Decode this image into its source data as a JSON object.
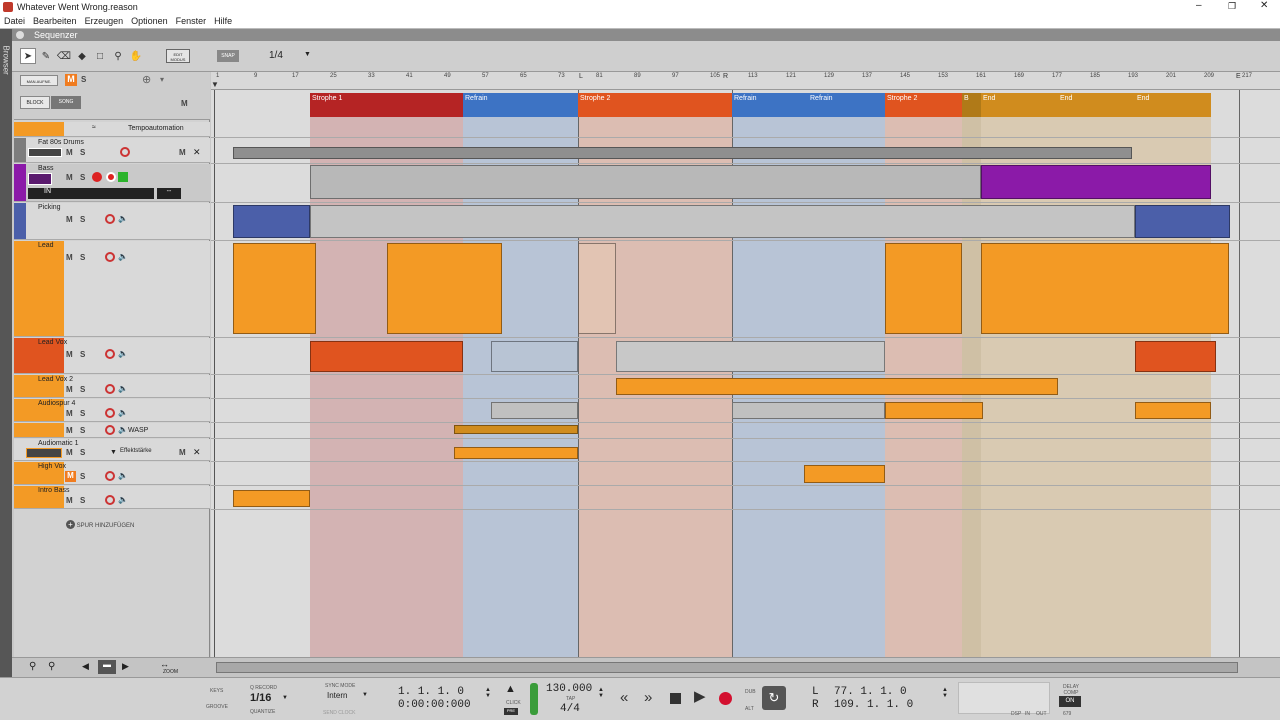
{
  "window": {
    "title": "Whatever Went Wrong.reason"
  },
  "menu": [
    "Datei",
    "Bearbeiten",
    "Erzeugen",
    "Optionen",
    "Fenster",
    "Hilfe"
  ],
  "browser_label": "Browser",
  "sequencer": {
    "title": "Sequenzer"
  },
  "toolbar": {
    "edit_mode": "EDIT MODUS",
    "snap": "SNAP",
    "snap_value": "1/4"
  },
  "header": {
    "man_aufn": "MAN.AUFNE.",
    "mute": "M",
    "solo": "S",
    "block": "BLOCK",
    "song": "SONG",
    "m": "M"
  },
  "ruler": [
    "1",
    "9",
    "17",
    "25",
    "33",
    "41",
    "49",
    "57",
    "65",
    "73",
    "81",
    "89",
    "97",
    "105",
    "113",
    "121",
    "129",
    "137",
    "145",
    "153",
    "161",
    "169",
    "177",
    "185",
    "193",
    "201",
    "209",
    "217"
  ],
  "sections": [
    {
      "label": "Strophe 1",
      "color": "#b52424"
    },
    {
      "label": "Refrain",
      "color": "#3d73c4"
    },
    {
      "label": "Strophe 2",
      "color": "#e0541f"
    },
    {
      "label": "Refrain",
      "color": "#3d73c4"
    },
    {
      "label": "Refrain",
      "color": "#3d73c4"
    },
    {
      "label": "Strophe 2",
      "color": "#e0541f"
    },
    {
      "label": "B",
      "color": "#b07a18"
    },
    {
      "label": "End",
      "color": "#d08c1e"
    },
    {
      "label": "End",
      "color": "#d08c1e"
    },
    {
      "label": "End",
      "color": "#d08c1e"
    }
  ],
  "tracks": [
    {
      "name": "Tempoautomation"
    },
    {
      "name": "Fat 80s Drums"
    },
    {
      "name": "Bass"
    },
    {
      "name": "Picking"
    },
    {
      "name": "Lead"
    },
    {
      "name": "Lead Vox"
    },
    {
      "name": "Lead Vox 2"
    },
    {
      "name": "Audiospur 4"
    },
    {
      "name": "WASP"
    },
    {
      "name": "Audiomatic 1",
      "extra": "Effektstärke"
    },
    {
      "name": "High Vox"
    },
    {
      "name": "Intro Bass"
    }
  ],
  "bass_input": "IN",
  "add_track": "SPUR HINZUFÜGEN",
  "zoom_label": "ZOOM",
  "transport": {
    "keys": "KEYS",
    "groove": "GROOVE",
    "qrecord": "Q RECORD",
    "quantize_value": "1/16",
    "quantize": "QUANTIZE",
    "sync_mode": "SYNC MODE",
    "sync_value": "Intern",
    "send_clock": "SEND CLOCK",
    "position_bars": "1.   1.   1.    0",
    "position_time": "0:00:00:000",
    "click": "CLICK",
    "pre": "PRE",
    "tempo": "130.000",
    "tap": "TAP",
    "signature": "4/4",
    "dub": "DUB",
    "alt": "ALT",
    "loop_left_label": "L",
    "loop_left": "77.   1.   1.    0",
    "loop_right_label": "R",
    "loop_right": "109.   1.   1.    0",
    "dsp": "DSP",
    "in": "IN",
    "out": "OUT",
    "delay_comp": "DELAY COMP",
    "on": "ON",
    "delay_value": "679"
  }
}
